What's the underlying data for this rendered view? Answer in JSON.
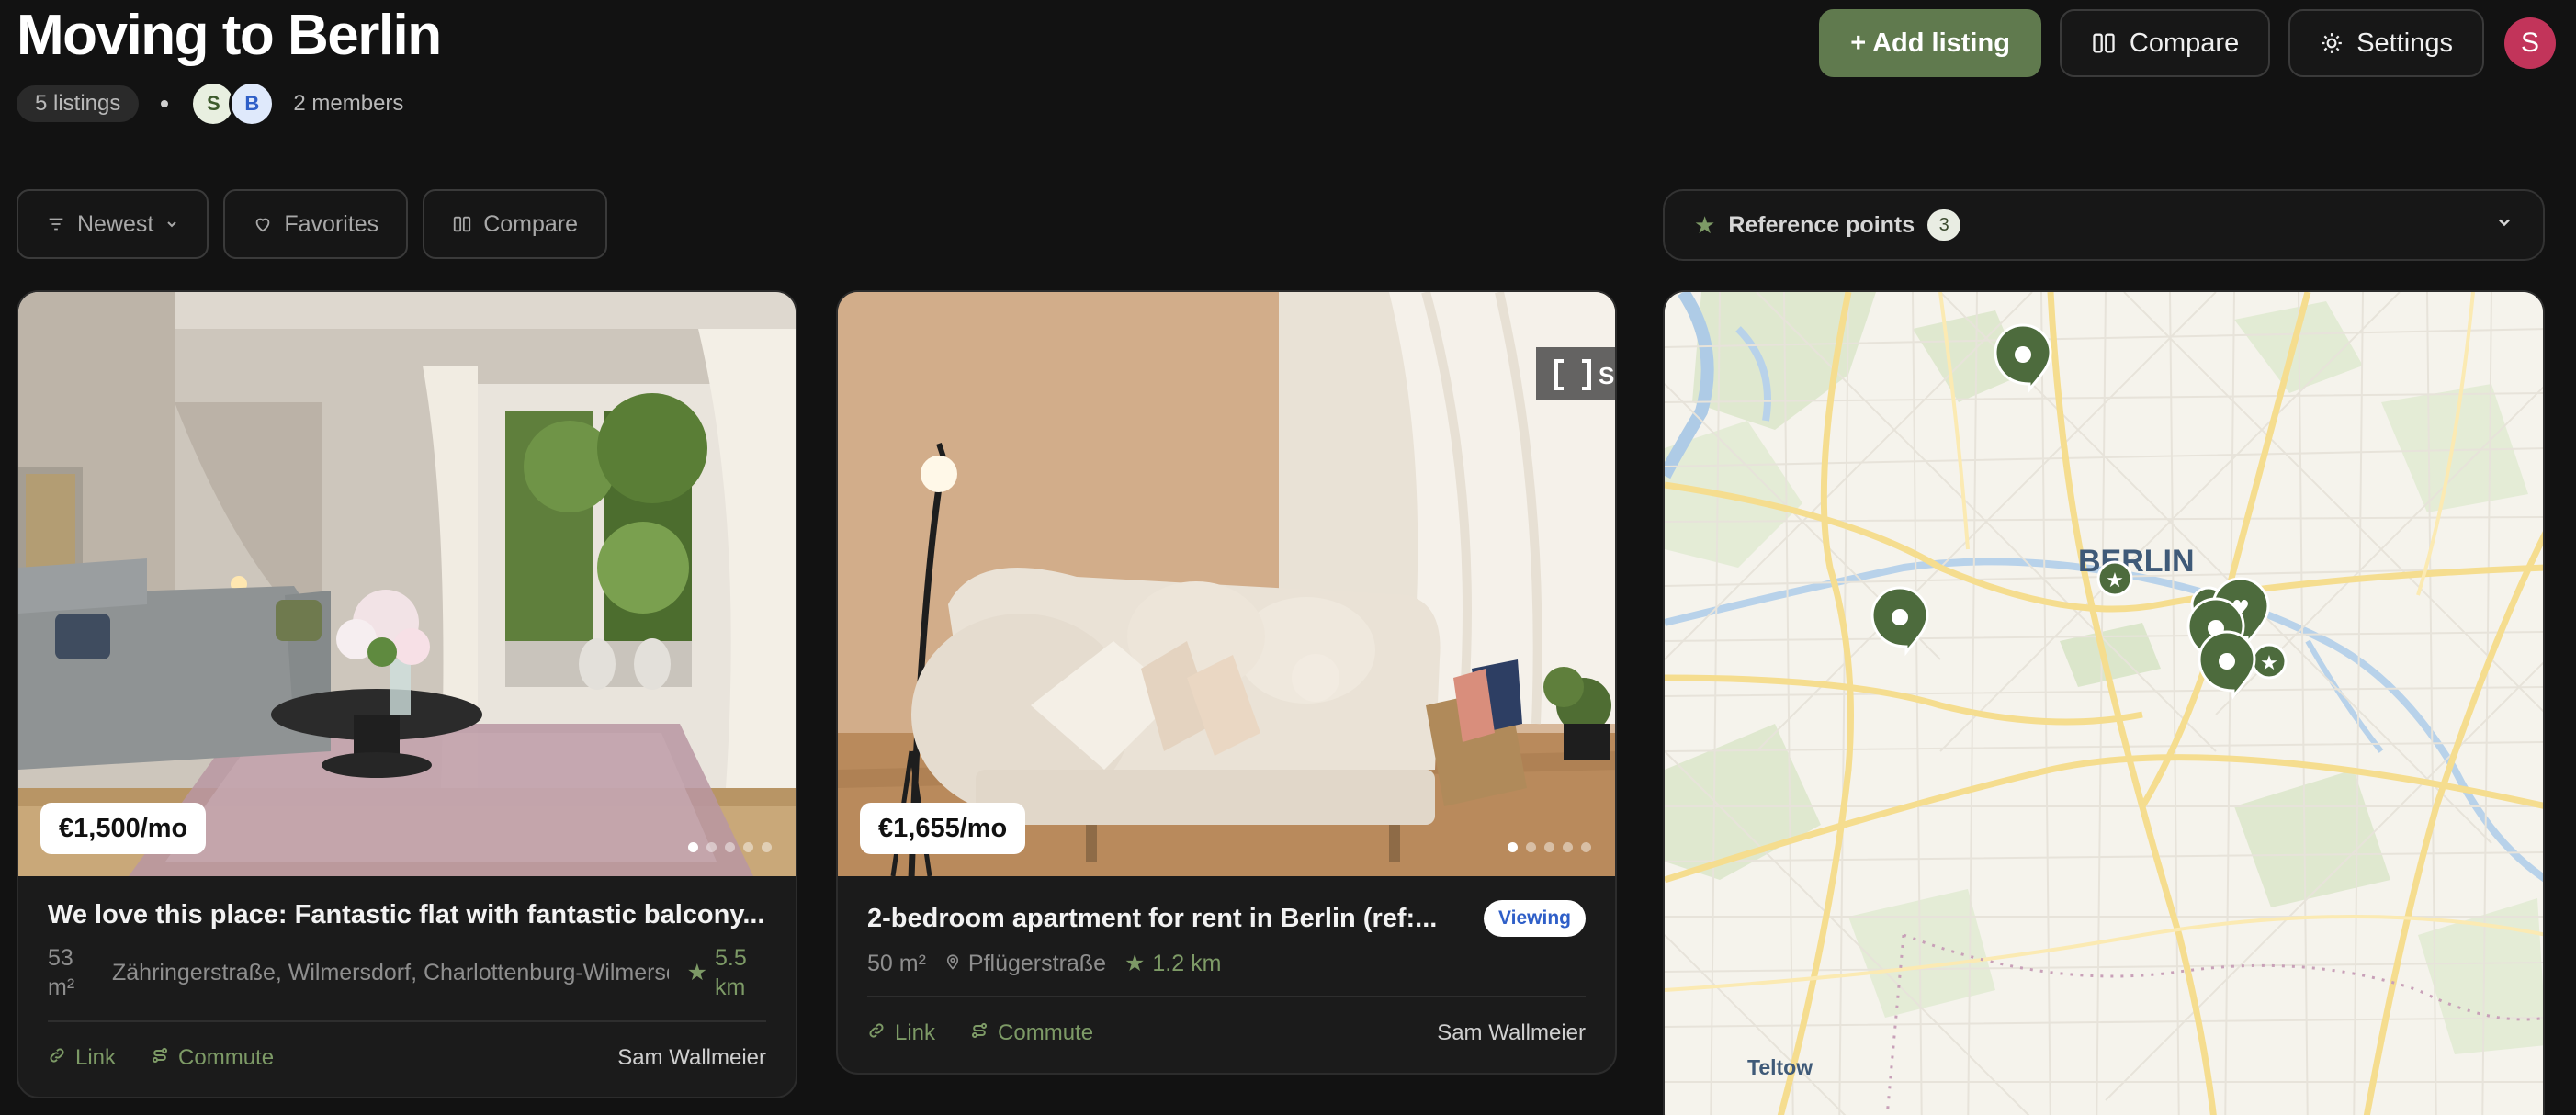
{
  "header": {
    "title": "Moving to Berlin",
    "listings_count": "5 listings",
    "members": [
      "S",
      "B"
    ],
    "members_text": "2 members",
    "add_listing": "+ Add listing",
    "compare": "Compare",
    "settings": "Settings",
    "user_initial": "S"
  },
  "filters": {
    "sort": "Newest",
    "favorites": "Favorites",
    "compare": "Compare"
  },
  "reference_points": {
    "label": "Reference points",
    "count": "3"
  },
  "listings": [
    {
      "price": "€1,500/mo",
      "title": "We love this place: Fantastic flat with fantastic balcony...",
      "area": "53 m²",
      "address": "Zähringerstraße, Wilmersdorf, Charlottenburg-Wilmersdorf",
      "distance": "5.5 km",
      "link": "Link",
      "commute": "Commute",
      "owner": "Sam Wallmeier",
      "photo_count": 5,
      "active_photo": 0
    },
    {
      "price": "€1,655/mo",
      "title": "2-bedroom apartment for rent in Berlin (ref:...",
      "status": "Viewing",
      "area": "50 m²",
      "address": "Pflügerstraße",
      "distance": "1.2 km",
      "link": "Link",
      "commute": "Commute",
      "owner": "Sam Wallmeier",
      "photo_count": 5,
      "active_photo": 0,
      "watermark": "SP"
    }
  ],
  "map": {
    "city_label": "BERLIN",
    "district_label": "Teltow"
  },
  "colors": {
    "accent": "#607a4e",
    "accent_text": "#7d9a66",
    "background": "#121212",
    "avatar": "#c2345a",
    "viewing": "#2f5fc8"
  }
}
